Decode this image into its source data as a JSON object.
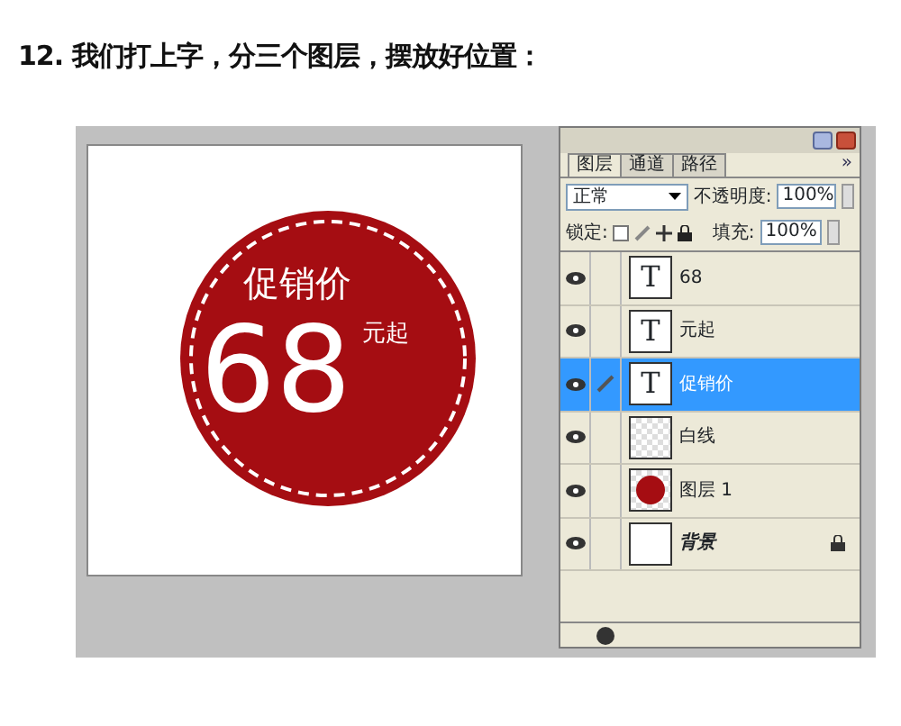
{
  "heading": "12. 我们打上字，分三个图层，摆放好位置：",
  "canvas": {
    "top_text": "促销价",
    "price": "68",
    "suffix": "元起"
  },
  "layers_panel": {
    "tabs": [
      {
        "label": "图层",
        "selected": true
      },
      {
        "label": "通道",
        "selected": false
      },
      {
        "label": "路径",
        "selected": false
      }
    ],
    "more": "»",
    "blend_mode": "正常",
    "opacity_label": "不透明度:",
    "opacity": "100%",
    "lock_label": "锁定:",
    "fill_label": "填充:",
    "fill": "100%",
    "layers": [
      {
        "name": "68",
        "kind": "text",
        "thumb": "T",
        "visible": true,
        "selected": false,
        "locked": false
      },
      {
        "name": "元起",
        "kind": "text",
        "thumb": "T",
        "visible": true,
        "selected": false,
        "locked": false
      },
      {
        "name": "促销价",
        "kind": "text",
        "thumb": "T",
        "visible": true,
        "selected": true,
        "locked": false
      },
      {
        "name": "白线",
        "kind": "empty",
        "visible": true,
        "selected": false,
        "locked": false
      },
      {
        "name": "图层 1",
        "kind": "shape",
        "visible": true,
        "selected": false,
        "locked": false
      },
      {
        "name": "背景",
        "kind": "background",
        "visible": true,
        "selected": false,
        "locked": true
      }
    ]
  }
}
